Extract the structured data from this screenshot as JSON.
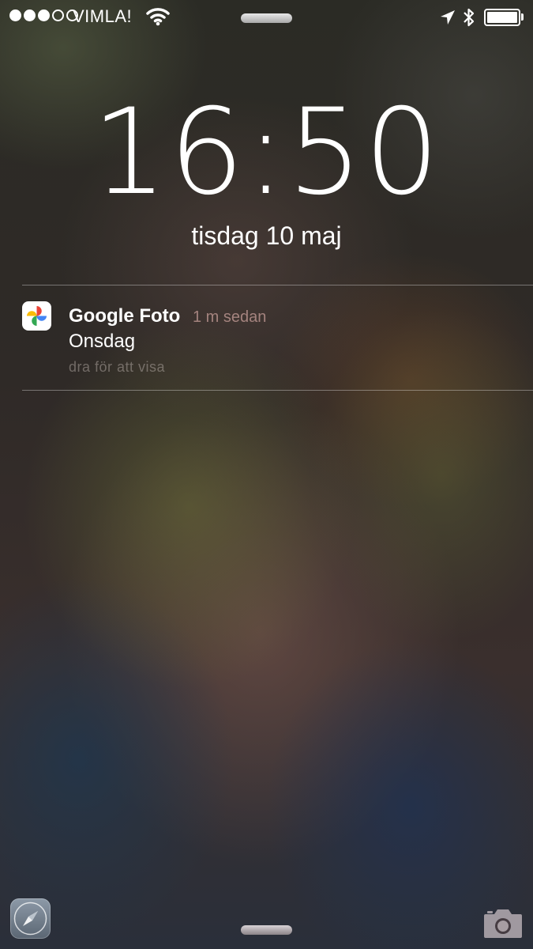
{
  "status_bar": {
    "signal_bars_filled": 3,
    "signal_bars_total": 5,
    "carrier": "VIMLA!",
    "icons": [
      "wifi-icon",
      "location-arrow-icon",
      "bluetooth-icon",
      "battery-icon"
    ],
    "battery_level": 1.0
  },
  "lock_screen": {
    "time": "16:50",
    "date": "tisdag 10 maj"
  },
  "notification": {
    "app_icon": "google-photos-icon",
    "app_name": "Google Foto",
    "time_ago": "1 m sedan",
    "message": "Onsdag",
    "hint": "dra för att visa"
  },
  "bottom_bar": {
    "left_icon": "safari-icon",
    "right_icon": "camera-icon"
  }
}
